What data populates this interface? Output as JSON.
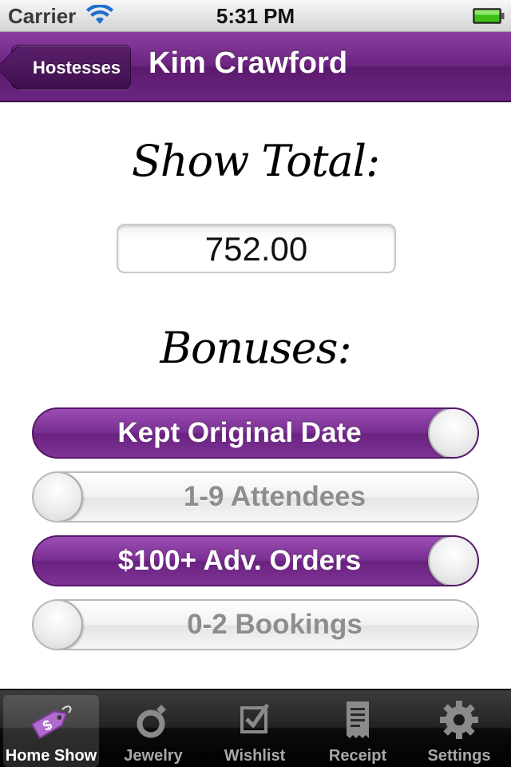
{
  "status_bar": {
    "carrier": "Carrier",
    "time": "5:31 PM",
    "wifi_icon": "wifi-icon",
    "battery_icon": "battery-icon"
  },
  "nav": {
    "back_label": "Hostesses",
    "title": "Kim Crawford"
  },
  "content": {
    "show_total_label": "Show Total:",
    "show_total_value": "752.00",
    "bonuses_label": "Bonuses:",
    "bonuses": [
      {
        "label": "Kept Original Date",
        "on": true
      },
      {
        "label": "1-9 Attendees",
        "on": false
      },
      {
        "label": "$100+ Adv. Orders",
        "on": true
      },
      {
        "label": "0-2 Bookings",
        "on": false
      }
    ]
  },
  "tab_bar": {
    "selected": "Home Show",
    "tabs": [
      {
        "label": "Home Show",
        "icon": "price-tag-icon"
      },
      {
        "label": "Jewelry",
        "icon": "ring-icon"
      },
      {
        "label": "Wishlist",
        "icon": "checkbox-icon"
      },
      {
        "label": "Receipt",
        "icon": "receipt-icon"
      },
      {
        "label": "Settings",
        "icon": "gear-icon"
      }
    ]
  },
  "colors": {
    "accent_purple": "#6c237f",
    "toggle_on": "#7a2f92",
    "toggle_off_text": "#8d8d8d",
    "battery_green": "#3fbf16"
  }
}
